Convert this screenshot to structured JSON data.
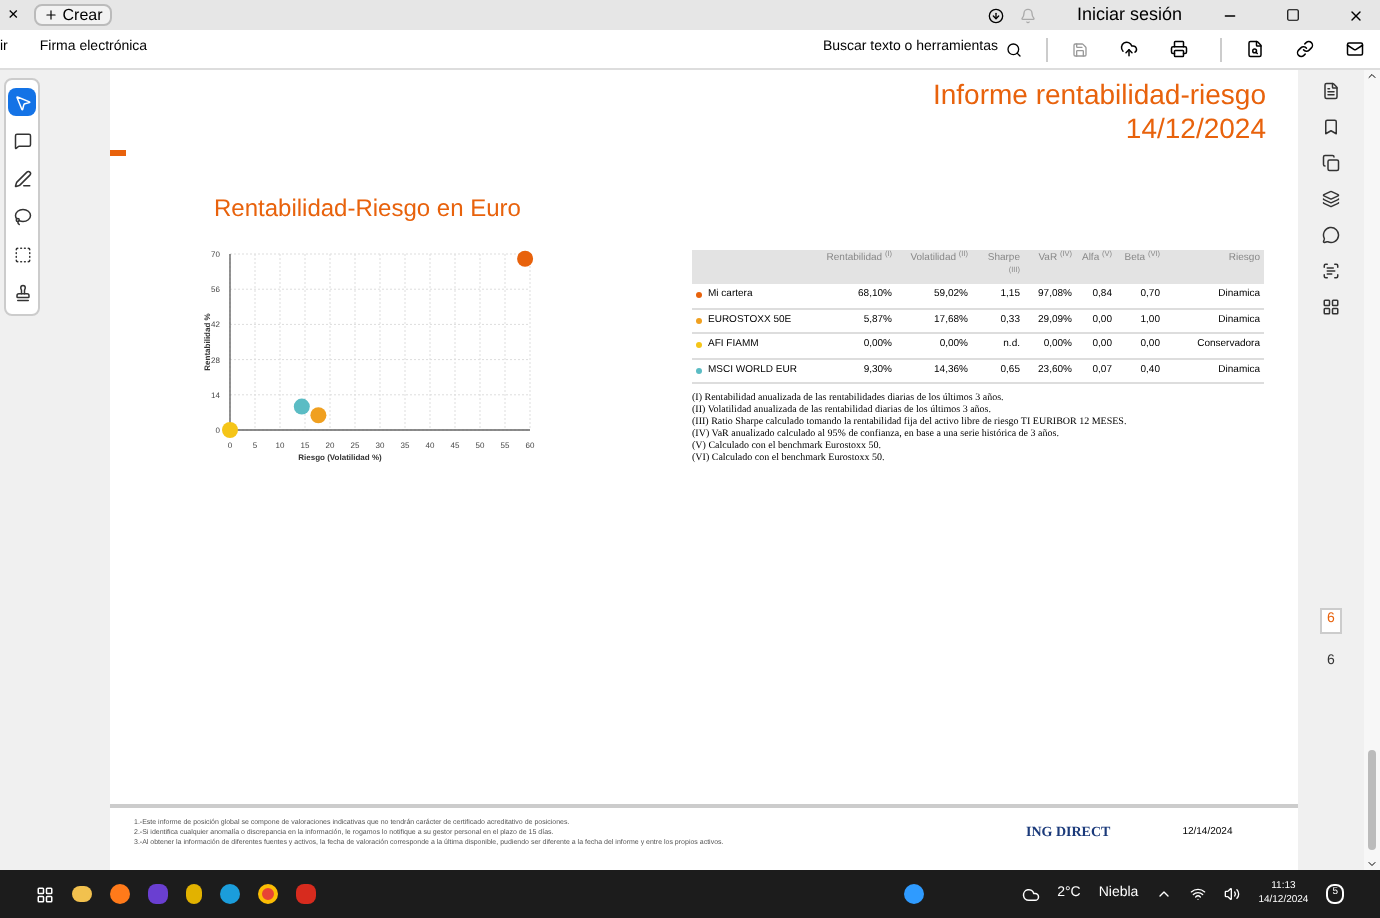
{
  "tabbar": {
    "close": "×",
    "new_button": "Crear",
    "sign_in": "Iniciar sesión"
  },
  "toolbar": {
    "items": [
      "ir",
      "Firma electrónica"
    ],
    "search": "Buscar texto o herramientas"
  },
  "tools": [
    {
      "kind": "select",
      "selected": true
    },
    {
      "kind": "comment",
      "selected": false
    },
    {
      "kind": "pen",
      "selected": false
    },
    {
      "kind": "lasso",
      "selected": false
    },
    {
      "kind": "text",
      "selected": false
    },
    {
      "kind": "stamp",
      "selected": false
    }
  ],
  "document": {
    "header_title": "Informe rentabilidad-riesgo",
    "header_date": "14/12/2024",
    "section_title": "Rentabilidad-Riesgo en Euro",
    "chart_data": {
      "type": "scatter",
      "grid": true,
      "xlabel": "Riesgo (Volatilidad %)",
      "ylabel": "Rentabilidad %",
      "xlim": [
        0,
        60
      ],
      "ylim": [
        0,
        70
      ],
      "xticks": [
        0,
        5,
        10,
        15,
        20,
        25,
        30,
        35,
        40,
        45,
        50,
        55,
        60
      ],
      "yticks": [
        0,
        14,
        28,
        42,
        56,
        70
      ],
      "series": [
        {
          "color": "#e8620c",
          "x": [
            59.02
          ],
          "values": [
            68.1
          ]
        },
        {
          "color": "#f0a020",
          "x": [
            17.68
          ],
          "values": [
            5.87
          ]
        },
        {
          "color": "#f5c518",
          "x": [
            0
          ],
          "values": [
            0
          ]
        },
        {
          "color": "#5bbcc4",
          "x": [
            14.36
          ],
          "values": [
            9.3
          ]
        }
      ]
    },
    "table": {
      "columns": [
        "Rentabilidad $^{(I)}$",
        "Volatilidad $^{(II)}$",
        "Sharpe $^{(III)}$",
        "VaR $^{(IV)}$",
        "Alfa $^{(V)}$",
        "Beta $^{(VI)}$",
        "Riesgo"
      ],
      "rows": [
        {
          "name": "Mi cartera",
          "color": "#e8620c",
          "cells": [
            "68,10%",
            "59,02%",
            "1,15",
            "97,08%",
            "0,84",
            "0,70",
            "Dinamica"
          ]
        },
        {
          "name": "EUROSTOXX 50E",
          "color": "#f0a020",
          "cells": [
            "5,87%",
            "17,68%",
            "0,33",
            "29,09%",
            "0,00",
            "1,00",
            "Dinamica"
          ]
        },
        {
          "name": "AFI FIAMM",
          "color": "#f5c518",
          "cells": [
            "0,00%",
            "0,00%",
            "n.d.",
            "0,00%",
            "0,00",
            "0,00",
            "Conservadora"
          ]
        },
        {
          "name": "MSCI WORLD EUR",
          "color": "#5bbcc4",
          "cells": [
            "9,30%",
            "14,36%",
            "0,65",
            "23,60%",
            "0,07",
            "0,40",
            "Dinamica"
          ]
        }
      ]
    },
    "notes": [
      "(I) Rentabilidad anualizada de las rentabilidades diarias de los últimos 3 años.",
      "(II) Volatilidad anualizada de las rentabilidad diarias de los últimos 3 años.",
      "(III) Ratio Sharpe calculado tomando la rentabilidad fija del activo libre de riesgo TI EURIBOR 12 MESES.",
      "(IV) VaR anualizado calculado al 95% de confianza, en base a una serie histórica de 3 años.",
      "(V) Calculado con el benchmark Eurostoxx 50.",
      "(VI) Calculado con el benchmark Eurostoxx 50."
    ],
    "footer_notes": [
      "1.-Este informe de posición global se compone de valoraciones indicativas que no tendrán carácter de certificado acreditativo de posiciones.",
      "2.-Si identifica cualquier anomalía o discrepancia en la información, le rogamos lo notifique a su gestor personal en el plazo de 15 días.",
      "3.-Al obtener la información de diferentes fuentes y activos, la fecha de valoración corresponde a la última disponible, pudiendo ser diferente a la fecha del informe y entre los propios activos."
    ],
    "footer_brand": "ING DIRECT",
    "footer_date": "12/14/2024"
  },
  "page_indicator": {
    "current": "6",
    "total": "6"
  },
  "taskbar": {
    "temperature": "2°C",
    "weather": "Niebla",
    "time": "11:13",
    "date": "14/12/2024",
    "notifications": "5"
  }
}
